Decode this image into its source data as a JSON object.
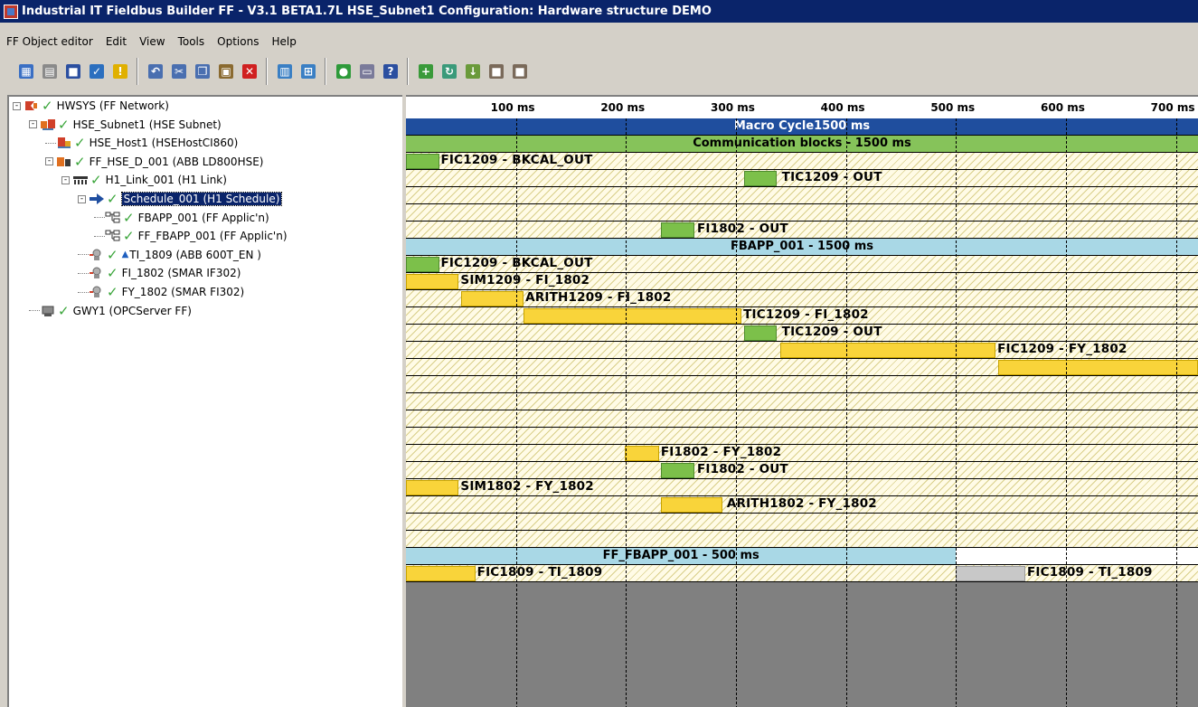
{
  "window": {
    "title": "Industrial IT Fieldbus Builder FF - V3.1 BETA1.7L HSE_Subnet1  Configuration: Hardware structure DEMO"
  },
  "menu": [
    "FF Object editor",
    "Edit",
    "View",
    "Tools",
    "Options",
    "Help"
  ],
  "toolbar": {
    "groups": [
      [
        "network-icon",
        "disabled-icon",
        "save-icon",
        "check-icon",
        "warning-icon"
      ],
      [
        "undo-icon",
        "cut-icon",
        "copy-icon",
        "paste-icon",
        "delete-icon"
      ],
      [
        "table-icon",
        "tree-icon"
      ],
      [
        "go-icon",
        "print-icon",
        "help-icon"
      ],
      [
        "add-icon",
        "refresh-icon",
        "download-icon",
        "stop-icon",
        "stop2-icon"
      ]
    ]
  },
  "tree": [
    {
      "label": "HWSYS (FF Network)",
      "level": 0,
      "expander": "-",
      "icon": "network"
    },
    {
      "label": "HSE_Subnet1 (HSE Subnet)",
      "level": 1,
      "expander": "-",
      "icon": "subnet"
    },
    {
      "label": "HSE_Host1 (HSEHostCI860)",
      "level": 2,
      "expander": "",
      "icon": "host"
    },
    {
      "label": "FF_HSE_D_001 (ABB LD800HSE)",
      "level": 2,
      "expander": "-",
      "icon": "device"
    },
    {
      "label": "H1_Link_001 (H1 Link)",
      "level": 3,
      "expander": "-",
      "icon": "link"
    },
    {
      "label": "Schedule_001 (H1 Schedule)",
      "level": 4,
      "expander": "-",
      "icon": "schedule",
      "selected": true
    },
    {
      "label": "FBAPP_001 (FF Applic'n)",
      "level": 5,
      "expander": "",
      "icon": "app"
    },
    {
      "label": "FF_FBAPP_001 (FF Applic'n)",
      "level": 5,
      "expander": "",
      "icon": "app"
    },
    {
      "label": "TI_1809 (ABB 600T_EN )",
      "level": 4,
      "expander": "",
      "icon": "fielddev",
      "triangle": true
    },
    {
      "label": "FI_1802 (SMAR IF302)",
      "level": 4,
      "expander": "",
      "icon": "fielddev"
    },
    {
      "label": "FY_1802 (SMAR FI302)",
      "level": 4,
      "expander": "",
      "icon": "fielddev"
    },
    {
      "label": "GWY1 (OPCServer FF)",
      "level": 1,
      "expander": "",
      "icon": "gateway"
    }
  ],
  "ruler": [
    "100 ms",
    "200 ms",
    "300 ms",
    "400 ms",
    "500 ms",
    "600 ms",
    "700 ms"
  ],
  "gantt": {
    "ms_visible": 720,
    "rows": [
      {
        "type": "band",
        "color": "#1f4e9e",
        "label": "Macro Cycle1500 ms",
        "text_color": "#ffffff"
      },
      {
        "type": "band",
        "color": "#86c35a",
        "label": "Communication blocks - 1500 ms",
        "text_color": "#000000"
      },
      {
        "type": "task",
        "blocks": [
          {
            "start": 0,
            "end": 30,
            "color": "green"
          }
        ],
        "label": "FIC1209 - BKCAL_OUT",
        "label_ms": 30
      },
      {
        "type": "task",
        "blocks": [
          {
            "start": 307,
            "end": 337,
            "color": "green"
          }
        ],
        "label": "TIC1209 - OUT",
        "label_ms": 340
      },
      {
        "type": "task",
        "blocks": [],
        "label": ""
      },
      {
        "type": "task",
        "blocks": [],
        "label": ""
      },
      {
        "type": "task",
        "blocks": [
          {
            "start": 232,
            "end": 262,
            "color": "green"
          }
        ],
        "label": "FI1802 - OUT",
        "label_ms": 263
      },
      {
        "type": "band",
        "color": "#a9d8e6",
        "label": "FBAPP_001 - 1500 ms",
        "text_color": "#000000"
      },
      {
        "type": "task",
        "blocks": [
          {
            "start": 0,
            "end": 30,
            "color": "green"
          }
        ],
        "label": "FIC1209 - BKCAL_OUT",
        "label_ms": 30
      },
      {
        "type": "task",
        "blocks": [
          {
            "start": 0,
            "end": 48,
            "color": "yellow"
          }
        ],
        "label": "SIM1209 - FI_1802",
        "label_ms": 48
      },
      {
        "type": "task",
        "blocks": [
          {
            "start": 50,
            "end": 107,
            "color": "yellow"
          }
        ],
        "label": "ARITH1209 - FI_1802",
        "label_ms": 107
      },
      {
        "type": "task",
        "blocks": [
          {
            "start": 107,
            "end": 305,
            "color": "yellow"
          }
        ],
        "label": "TIC1209 - FI_1802",
        "label_ms": 305
      },
      {
        "type": "task",
        "blocks": [
          {
            "start": 307,
            "end": 337,
            "color": "green"
          }
        ],
        "label": "TIC1209 - OUT",
        "label_ms": 340
      },
      {
        "type": "task",
        "blocks": [
          {
            "start": 340,
            "end": 536,
            "color": "yellow"
          }
        ],
        "label": "FIC1209 - FY_1802",
        "label_ms": 536
      },
      {
        "type": "task",
        "blocks": [
          {
            "start": 538,
            "end": 720,
            "color": "yellow"
          }
        ],
        "label": "",
        "label_ms": 0
      },
      {
        "type": "task",
        "blocks": [],
        "label": ""
      },
      {
        "type": "task",
        "blocks": [],
        "label": ""
      },
      {
        "type": "task",
        "blocks": [],
        "label": ""
      },
      {
        "type": "task",
        "blocks": [],
        "label": ""
      },
      {
        "type": "task",
        "blocks": [
          {
            "start": 199,
            "end": 230,
            "color": "yellow"
          }
        ],
        "label": "FI1802 - FY_1802",
        "label_ms": 230
      },
      {
        "type": "task",
        "blocks": [
          {
            "start": 232,
            "end": 262,
            "color": "green"
          }
        ],
        "label": "FI1802 - OUT",
        "label_ms": 263
      },
      {
        "type": "task",
        "blocks": [
          {
            "start": 0,
            "end": 48,
            "color": "yellow"
          }
        ],
        "label": "SIM1802 - FY_1802",
        "label_ms": 48
      },
      {
        "type": "task",
        "blocks": [
          {
            "start": 232,
            "end": 288,
            "color": "yellow"
          }
        ],
        "label": "ARITH1802 - FY_1802",
        "label_ms": 290
      },
      {
        "type": "task",
        "blocks": [],
        "label": ""
      },
      {
        "type": "task",
        "blocks": [],
        "label": ""
      },
      {
        "type": "band",
        "color": "#a9d8e6",
        "label": "FF_FBAPP_001 - 500 ms",
        "text_color": "#000000",
        "band_end": 500
      },
      {
        "type": "task",
        "blocks": [
          {
            "start": 0,
            "end": 63,
            "color": "yellow"
          },
          {
            "start": 500,
            "end": 563,
            "color": "grey"
          }
        ],
        "label": "FIC1809 - TI_1809",
        "label_ms": 63,
        "label2": "FIC1809 - TI_1809",
        "label2_ms": 563
      }
    ]
  }
}
